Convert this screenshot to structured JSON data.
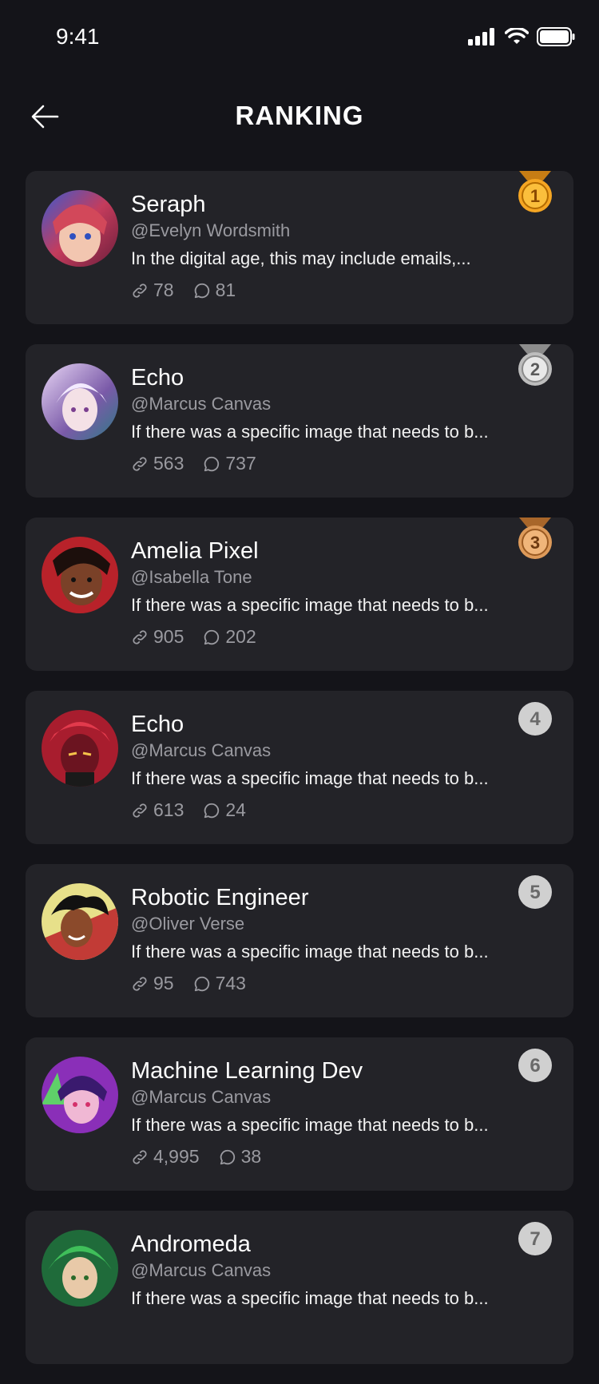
{
  "status_bar": {
    "time": "9:41"
  },
  "header": {
    "title": "RANKING"
  },
  "colors": {
    "background": "#141419",
    "card": "#232328",
    "gold": "#f5a623",
    "silver": "#bdbdbd",
    "bronze": "#dd9a5a",
    "rank_gray": "#d0d0d0"
  },
  "icons": {
    "back": "arrow-left-icon",
    "link": "link-icon",
    "comment": "comment-icon"
  },
  "ranking": [
    {
      "rank": "1",
      "name": "Seraph",
      "handle": "@Evelyn Wordsmith",
      "desc": "In the digital age, this may include emails,...",
      "links": "78",
      "comments": "81"
    },
    {
      "rank": "2",
      "name": "Echo",
      "handle": "@Marcus Canvas",
      "desc": "If there was a specific image that needs to b...",
      "links": "563",
      "comments": "737"
    },
    {
      "rank": "3",
      "name": "Amelia Pixel",
      "handle": "@Isabella Tone",
      "desc": "If there was a specific image that needs to b...",
      "links": "905",
      "comments": "202"
    },
    {
      "rank": "4",
      "name": "Echo",
      "handle": "@Marcus Canvas",
      "desc": "If there was a specific image that needs to b...",
      "links": "613",
      "comments": "24"
    },
    {
      "rank": "5",
      "name": "Robotic Engineer",
      "handle": "@Oliver Verse",
      "desc": "If there was a specific image that needs to b...",
      "links": "95",
      "comments": "743"
    },
    {
      "rank": "6",
      "name": "Machine Learning Dev",
      "handle": "@Marcus Canvas",
      "desc": "If there was a specific image that needs to b...",
      "links": "4,995",
      "comments": "38"
    },
    {
      "rank": "7",
      "name": "Andromeda",
      "handle": "@Marcus Canvas",
      "desc": "If there was a specific image that needs to b...",
      "links": "",
      "comments": ""
    }
  ]
}
